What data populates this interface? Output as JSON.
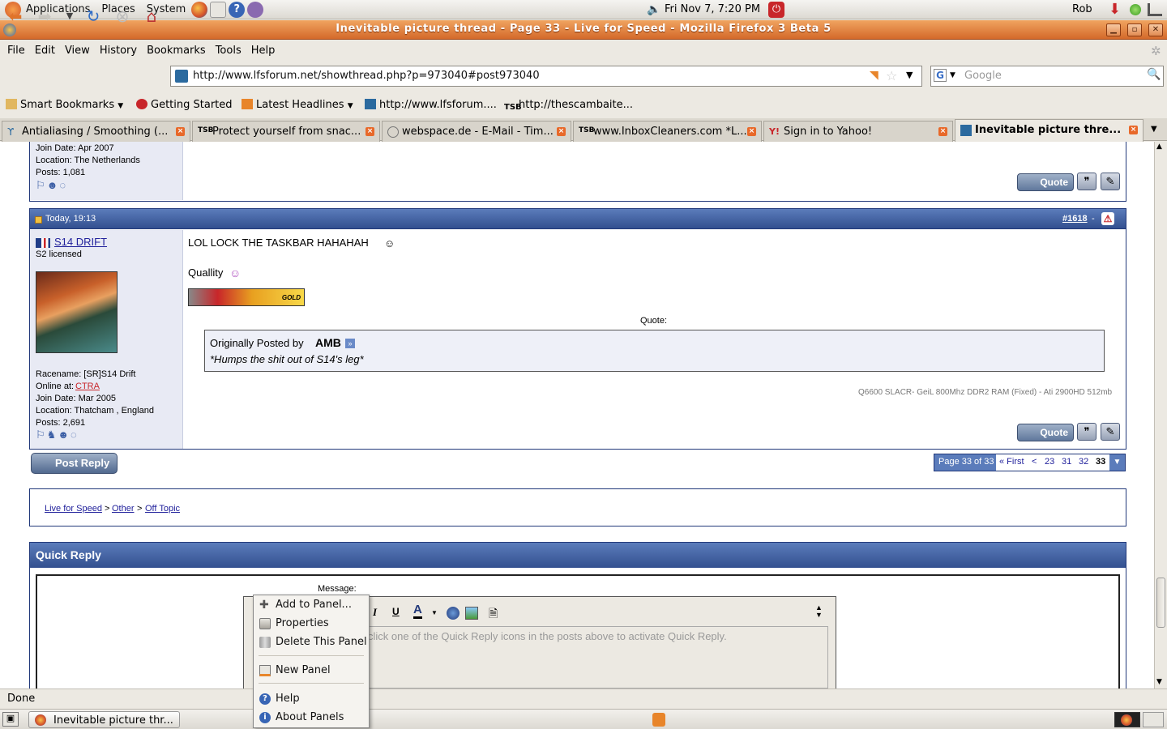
{
  "panel": {
    "applications": "Applications",
    "places": "Places",
    "system": "System",
    "clock": "Fri Nov  7,  7:20 PM",
    "user": "Rob"
  },
  "window": {
    "title": "Inevitable picture thread - Page 33 - Live for Speed - Mozilla Firefox 3 Beta 5"
  },
  "menubar": [
    "File",
    "Edit",
    "View",
    "History",
    "Bookmarks",
    "Tools",
    "Help"
  ],
  "nav": {
    "url": "http://www.lfsforum.net/showthread.php?p=973040#post973040",
    "search_placeholder": "Google"
  },
  "bookmarks": [
    "Smart Bookmarks",
    "Getting Started",
    "Latest Headlines",
    "http://www.lfsforum....",
    "http://thescambaite..."
  ],
  "tabs": [
    {
      "label": "Antialiasing / Smoothing (..."
    },
    {
      "label": "Protect yourself from snac..."
    },
    {
      "label": "webspace.de - E-Mail - Tim..."
    },
    {
      "label": "www.InboxCleaners.com *L..."
    },
    {
      "label": "Sign in to Yahoo!"
    },
    {
      "label": "Inevitable picture thre..."
    }
  ],
  "prev_post": {
    "join_date": "Join Date: Apr 2007",
    "location": "Location: The Netherlands",
    "posts": "Posts: 1,081",
    "quote_label": "Quote"
  },
  "post": {
    "timestamp": "Today, 19:13",
    "number": "#1618",
    "number_suffix": "-",
    "username": "S14 DRIFT",
    "rank": "S2 licensed",
    "racename": "Racename: [SR]S14 Drift",
    "online_at_label": "Online at:",
    "online_at_value": "CTRA",
    "join_date": "Join Date: Mar 2005",
    "location": "Location: Thatcham , England",
    "posts": "Posts: 2,691",
    "line1": "LOL LOCK THE TASKBAR HAHAHAH",
    "line2": "Quallity",
    "banner_text": "GOLD",
    "quote_header": "Quote:",
    "quote_by_prefix": "Originally Posted by",
    "quote_author": "AMB",
    "quote_text": "*Humps the shit out of S14's leg*",
    "signature": "Q6600 SLACR- GeiL 800Mhz DDR2 RAM (Fixed) - Ati 2900HD 512mb",
    "quote_label": "Quote"
  },
  "post_reply": "Post Reply",
  "pagination": {
    "label": "Page 33 of 33",
    "first": "« First",
    "prev": "<",
    "pages": [
      "23",
      "31",
      "32",
      "33"
    ]
  },
  "breadcrumb": {
    "items": [
      "Live for Speed",
      "Other",
      "Off Topic"
    ],
    "sep": ">"
  },
  "quick_reply": {
    "title": "Quick Reply",
    "message_label": "Message:",
    "hint": "click one of the Quick Reply icons in the posts above to activate Quick Reply."
  },
  "status": "Done",
  "taskbar": {
    "window": "Inevitable picture thr..."
  },
  "context_menu": [
    {
      "label": "Add to Panel..."
    },
    {
      "label": "Properties"
    },
    {
      "label": "Delete This Panel"
    },
    {
      "label": "New Panel"
    },
    {
      "label": "Help"
    },
    {
      "label": "About Panels"
    }
  ],
  "colors": {
    "titlebar": "#d4692a",
    "forum_blue": "#22397a",
    "post_header": "#3b5ea5"
  }
}
